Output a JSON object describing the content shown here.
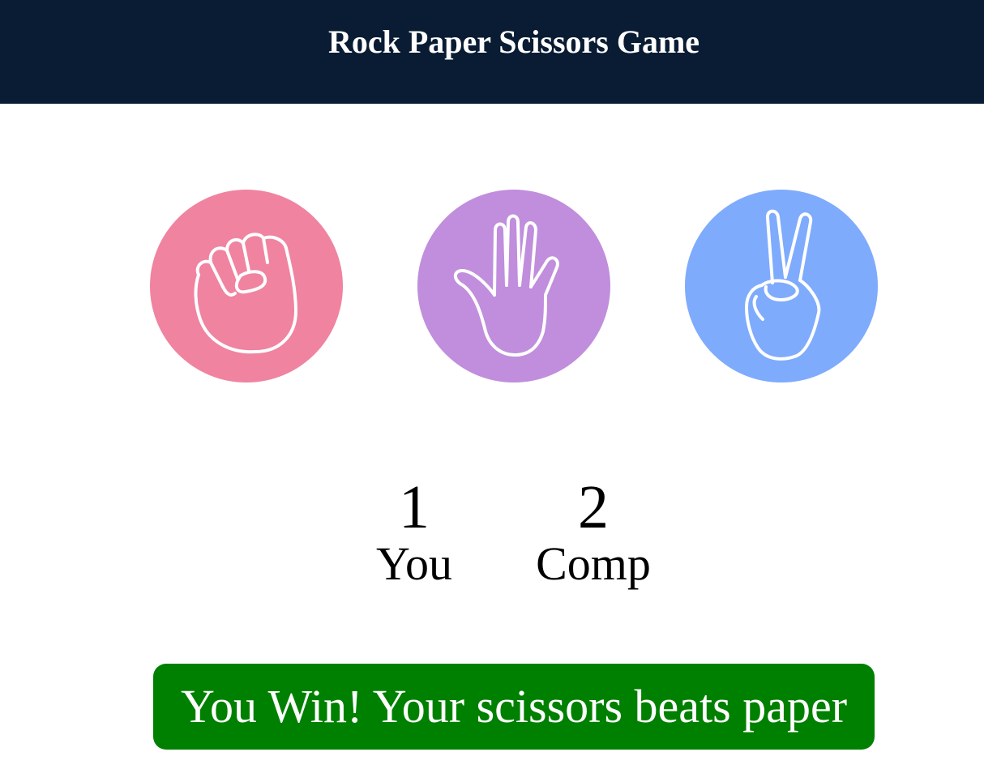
{
  "header": {
    "title": "Rock Paper Scissors Game"
  },
  "choices": [
    {
      "id": "rock",
      "icon": "fist-icon",
      "color": "#f083a0"
    },
    {
      "id": "paper",
      "icon": "open-hand-icon",
      "color": "#c08edc"
    },
    {
      "id": "scissors",
      "icon": "peace-hand-icon",
      "color": "#7fabfc"
    }
  ],
  "scoreboard": {
    "user": {
      "score": "1",
      "label": "You"
    },
    "comp": {
      "score": "2",
      "label": "Comp"
    }
  },
  "message": {
    "text": "You Win! Your scissors beats paper",
    "color": "#008000"
  }
}
